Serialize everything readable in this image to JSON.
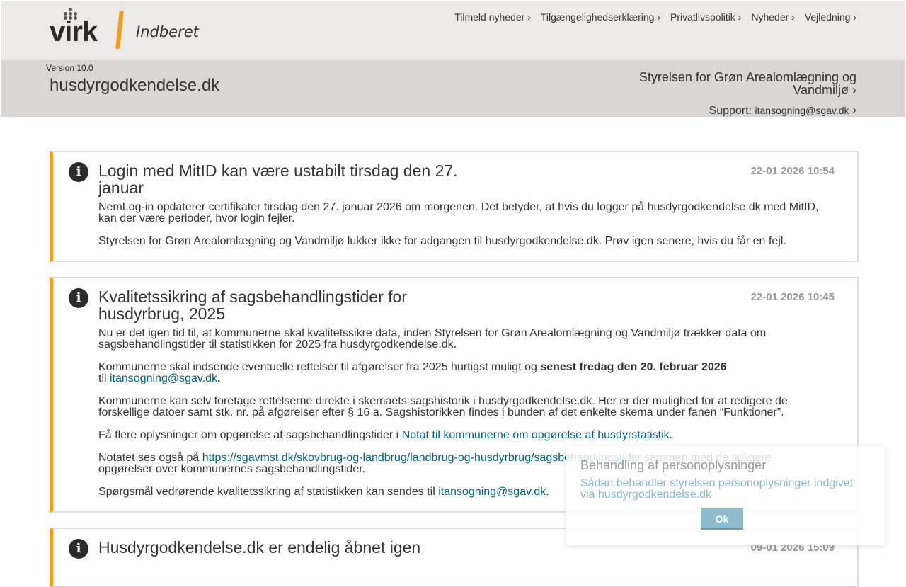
{
  "header": {
    "logo_text": "virk",
    "logo_subtitle": "Indberet",
    "nav": [
      {
        "label": "Tilmeld nyheder ›"
      },
      {
        "label": "Tilgængelighedserklæring ›"
      },
      {
        "label": "Privatlivspolitik ›"
      },
      {
        "label": "Nyheder ›"
      },
      {
        "label": "Vejledning ›"
      }
    ],
    "brand_colors": {
      "accent": "#f29b1d",
      "link": "#00617f"
    }
  },
  "subheader": {
    "version": "Version 10.0",
    "site_name": "husdyrgodkendelse.dk",
    "agency_link": "Styrelsen for Grøn Arealomlægning og Vandmiljø",
    "support_label": "Support:",
    "support_email": "itansogning@sgav.dk"
  },
  "news": [
    {
      "title": "Login med MitID kan være ustabilt tirsdag den 27. januar",
      "date": "22-01 2026 10:54",
      "p1": "NemLog-in opdaterer certifikater tirsdag den 27. januar 2026 om morgenen. Det betyder, at hvis du logger på husdyrgodkendelse.dk med MitID, kan der være perioder, hvor login fejler.",
      "p2": "Styrelsen for Grøn Arealomlægning og Vandmiljø lukker ikke for adgangen til husdyrgodkendelse.dk. Prøv igen senere, hvis du får en fejl."
    },
    {
      "title": "Kvalitetssikring af sagsbehandlingstider for husdyrbrug, 2025",
      "date": "22-01 2026 10:45",
      "p1": "Nu er det igen tid til, at kommunerne skal kvalitetssikre data, inden Styrelsen for Grøn Arealomlægning og Vandmiljø trækker data om sagsbehandlingstider til statistikken for 2025 fra husdyrgodkendelse.dk.",
      "p2_a": "Kommunerne skal indsende eventuelle rettelser til afgørelser fra 2025 hurtigst muligt og ",
      "p2_bold": "senest fredag den 20. februar 2026",
      "p2_b": " til ",
      "p2_link": "itansogning@sgav.dk",
      "p2_end": ".",
      "p3": "Kommunerne kan selv foretage rettelserne direkte i skemaets sagshistorik i husdyrgodkendelse.dk. Her er der mulighed for at redigere de forskellige datoer samt stk. nr. på afgørelser efter § 16 a. Sagshistorikken findes i bunden af det enkelte skema under fanen “Funktioner”.",
      "p4_a": "Få flere oplysninger om opgørelse af sagsbehandlingstider i ",
      "p4_link": "Notat til kommunerne om opgørelse af husdyrstatistik",
      "p4_end": ".",
      "p5_a": "Notatet ses også på ",
      "p5_link": "https://sgavmst.dk/skovbrug-og-landbrug/landbrug-og-husdyrbrug/sagsbehandlingstider",
      "p5_b": " sammen med de tidligere opgørelser over kommunernes sagsbehandlingstider.",
      "p6_a": "Spørgsmål vedrørende kvalitetssikring af statistikken kan sendes til ",
      "p6_link": "itansogning@sgav.dk",
      "p6_end": "."
    },
    {
      "title": "Husdyrgodkendelse.dk er endelig åbnet igen",
      "date": "09-01 2026 15:09"
    }
  ],
  "cookie": {
    "title": "Behandling af personoplysninger",
    "link": "Sådan behandler styrelsen personoplysninger indgivet via husdyrgodkendelse.dk",
    "ok": "Ok"
  }
}
